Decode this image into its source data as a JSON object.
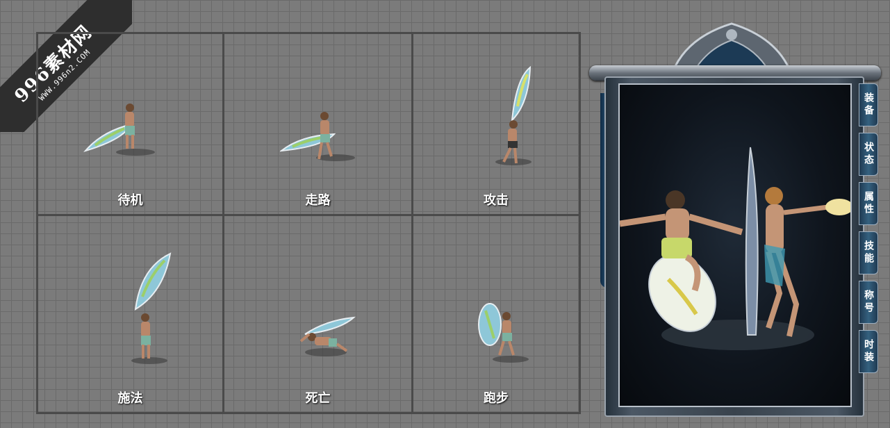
{
  "watermark": {
    "main": "996素材网",
    "sub": "WWW.996n2.COM"
  },
  "animations": [
    {
      "label": "待机"
    },
    {
      "label": "走路"
    },
    {
      "label": "攻击"
    },
    {
      "label": "施法"
    },
    {
      "label": "死亡"
    },
    {
      "label": "跑步"
    }
  ],
  "character_panel": {
    "tabs": [
      {
        "label": "装备"
      },
      {
        "label": "状态"
      },
      {
        "label": "属性"
      },
      {
        "label": "技能"
      },
      {
        "label": "称号"
      },
      {
        "label": "时装"
      }
    ]
  },
  "colors": {
    "background": "#7b7b7b",
    "grid_line": "#6a6a6a",
    "tab_blue": "#35617f",
    "frame_silver": "#b9c1ca"
  }
}
